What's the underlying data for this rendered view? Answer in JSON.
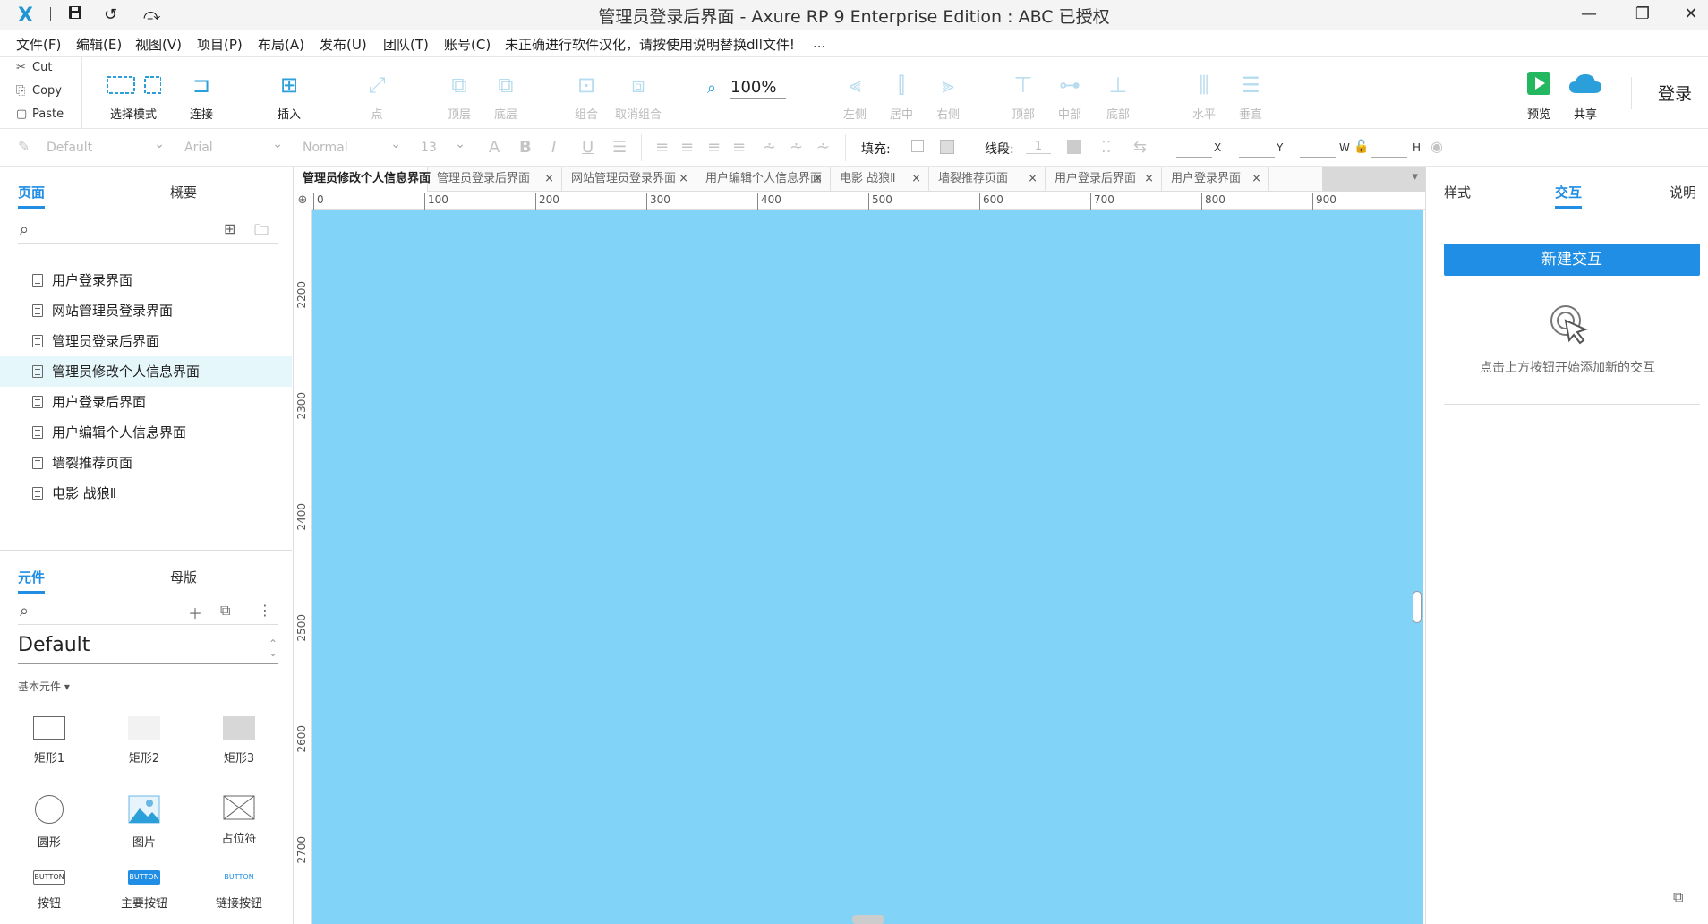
{
  "app": {
    "logo": "X",
    "title": "管理员登录后界面 - Axure RP 9 Enterprise Edition : ABC 已授权"
  },
  "menu": [
    "文件(F)",
    "编辑(E)",
    "视图(V)",
    "项目(P)",
    "布局(A)",
    "发布(U)",
    "团队(T)",
    "账号(C)",
    "未正确进行软件汉化，请按使用说明替换dll文件!",
    "..."
  ],
  "clipboard": {
    "cut": "Cut",
    "copy": "Copy",
    "paste": "Paste"
  },
  "toolbar": {
    "select_mode": "选择模式",
    "connect": "连接",
    "insert": "插入",
    "point": "点",
    "top_layer": "顶层",
    "bottom_layer": "底层",
    "group": "组合",
    "ungroup": "取消组合",
    "zoom": "100%",
    "align_left": "左侧",
    "align_center": "居中",
    "align_right": "右侧",
    "align_top": "顶部",
    "align_middle": "中部",
    "align_bottom": "底部",
    "dist_horizontal": "水平",
    "dist_vertical": "垂直",
    "preview": "预览",
    "share": "共享",
    "login": "登录"
  },
  "formatbar": {
    "style": "Default",
    "font": "Arial",
    "weight": "Normal",
    "size": "13",
    "fill_label": "填充:",
    "stroke_label": "线段:",
    "stroke_value": "1",
    "x_label": "X",
    "y_label": "Y",
    "w_label": "W",
    "h_label": "H"
  },
  "left_panel": {
    "tabs": {
      "pages": "页面",
      "outline": "概要"
    },
    "pages": [
      "用户登录界面",
      "网站管理员登录界面",
      "管理员登录后界面",
      "管理员修改个人信息界面",
      "用户登录后界面",
      "用户编辑个人信息界面",
      "墙裂推荐页面",
      "电影 战狼Ⅱ"
    ],
    "lib_tabs": {
      "widgets": "元件",
      "masters": "母版"
    },
    "library": "Default",
    "group": "基本元件 ▾",
    "widgets": [
      "矩形1",
      "矩形2",
      "矩形3",
      "圆形",
      "图片",
      "占位符",
      "按钮",
      "主要按钮",
      "链接按钮"
    ],
    "button_text": "BUTTON"
  },
  "doc_tabs": [
    "管理员修改个人信息界面",
    "管理员登录后界面",
    "网站管理员登录界面",
    "用户编辑个人信息界面",
    "电影 战狼Ⅱ",
    "墙裂推荐页面",
    "用户登录后界面",
    "用户登录界面"
  ],
  "ruler": {
    "h": [
      "0",
      "100",
      "200",
      "300",
      "400",
      "500",
      "600",
      "700",
      "800",
      "900"
    ],
    "v": [
      "2200",
      "2300",
      "2400",
      "2500",
      "2600",
      "2700"
    ]
  },
  "right_panel": {
    "tabs": {
      "style": "样式",
      "interactions": "交互",
      "notes": "说明"
    },
    "new_interaction": "新建交互",
    "hint": "点击上方按钮开始添加新的交互"
  },
  "colors": {
    "canvas": "#81d3f7",
    "accent": "#1f8ee4"
  }
}
